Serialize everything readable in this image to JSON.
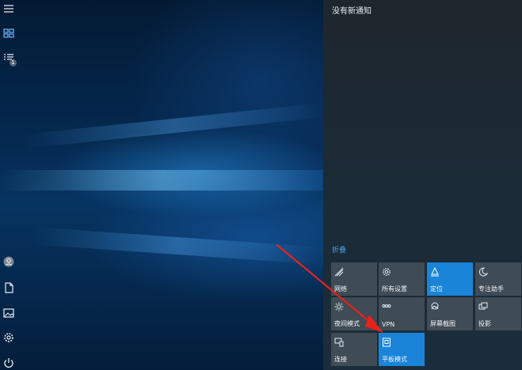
{
  "notification_center": {
    "header": "没有新通知",
    "collapse_label": "折叠",
    "tiles": [
      {
        "label": "网络",
        "icon": "network-icon",
        "active": false
      },
      {
        "label": "所有设置",
        "icon": "settings-icon",
        "active": false
      },
      {
        "label": "定位",
        "icon": "location-icon",
        "active": true
      },
      {
        "label": "专注助手",
        "icon": "moon-icon",
        "active": false
      },
      {
        "label": "夜间模式",
        "icon": "brightness-icon",
        "active": false
      },
      {
        "label": "VPN",
        "icon": "vpn-icon",
        "active": false
      },
      {
        "label": "屏幕截图",
        "icon": "screenshot-icon",
        "active": false
      },
      {
        "label": "投影",
        "icon": "project-icon",
        "active": false
      },
      {
        "label": "连接",
        "icon": "connect-icon",
        "active": false
      },
      {
        "label": "平板模式",
        "icon": "tablet-mode-icon",
        "active": true
      }
    ]
  },
  "left_rail": {
    "items": [
      {
        "icon": "hamburger-menu-icon"
      },
      {
        "icon": "tiles-icon"
      },
      {
        "icon": "list-icon",
        "badge": "1"
      },
      {
        "icon": "user-avatar-icon"
      },
      {
        "icon": "document-icon"
      },
      {
        "icon": "pictures-icon"
      },
      {
        "icon": "settings-icon"
      },
      {
        "icon": "power-icon"
      }
    ]
  },
  "colors": {
    "accent": "#1a84d8",
    "tile_inactive": "#3f4b55",
    "annotation_arrow": "#e8211b"
  }
}
